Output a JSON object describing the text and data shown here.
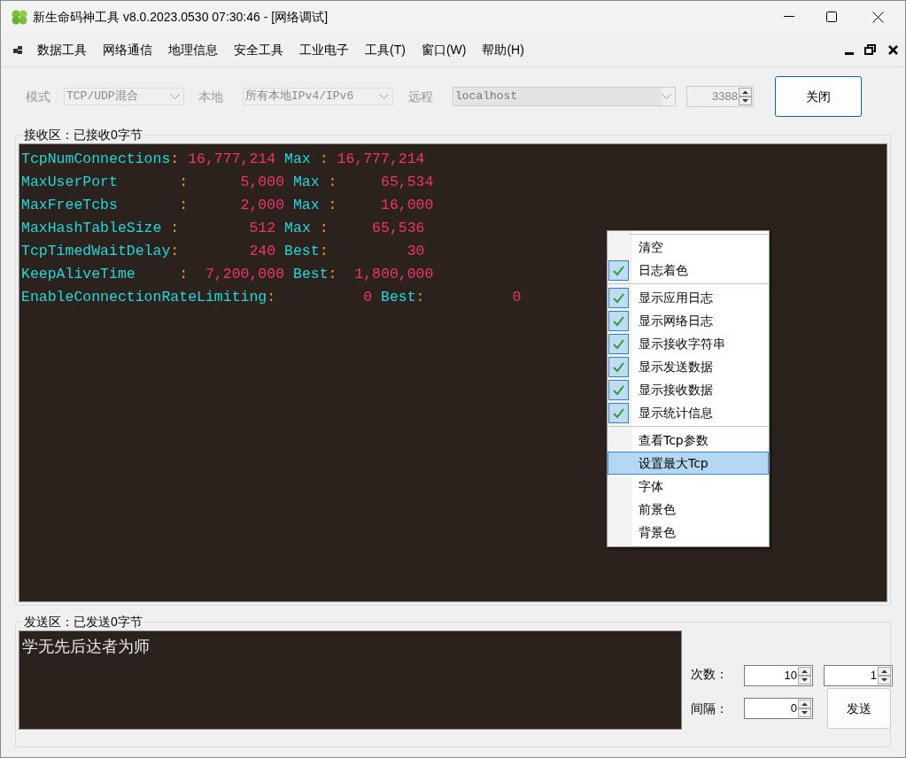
{
  "window": {
    "title": "新生命码神工具 v8.0.2023.0530 07:30:46 - [网络调试]"
  },
  "menu": [
    "数据工具",
    "网络通信",
    "地理信息",
    "安全工具",
    "工业电子",
    "工具(T)",
    "窗口(W)",
    "帮助(H)"
  ],
  "toolbar": {
    "mode_label": "模式",
    "mode": "TCP/UDP混合",
    "local_label": "本地",
    "local": "所有本地IPv4/IPv6",
    "remote_label": "远程",
    "remote": "localhost",
    "port": "3388",
    "close_button": "关闭"
  },
  "receive": {
    "title": "接收区：已接收0字节",
    "lines": [
      [
        {
          "kind": "name",
          "text": "TcpNumConnections"
        },
        {
          "kind": "sep",
          "text": ":"
        },
        {
          "kind": "value",
          "text": " 16,777,214"
        },
        {
          "kind": "label",
          "text": " Max"
        },
        {
          "kind": "sep",
          "text": " :"
        },
        {
          "kind": "value",
          "text": " 16,777,214"
        }
      ],
      [
        {
          "kind": "name",
          "text": "MaxUserPort"
        },
        {
          "kind": "sep",
          "text": "       :"
        },
        {
          "kind": "value",
          "text": "      5,000"
        },
        {
          "kind": "label",
          "text": " Max"
        },
        {
          "kind": "sep",
          "text": " :"
        },
        {
          "kind": "value",
          "text": "     65,534"
        }
      ],
      [
        {
          "kind": "name",
          "text": "MaxFreeTcbs"
        },
        {
          "kind": "sep",
          "text": "       :"
        },
        {
          "kind": "value",
          "text": "      2,000"
        },
        {
          "kind": "label",
          "text": " Max"
        },
        {
          "kind": "sep",
          "text": " :"
        },
        {
          "kind": "value",
          "text": "     16,000"
        }
      ],
      [
        {
          "kind": "name",
          "text": "MaxHashTableSize"
        },
        {
          "kind": "sep",
          "text": " :"
        },
        {
          "kind": "value",
          "text": "        512"
        },
        {
          "kind": "label",
          "text": " Max"
        },
        {
          "kind": "sep",
          "text": " :"
        },
        {
          "kind": "value",
          "text": "     65,536"
        }
      ],
      [
        {
          "kind": "name",
          "text": "TcpTimedWaitDelay"
        },
        {
          "kind": "sep",
          "text": ":"
        },
        {
          "kind": "value",
          "text": "        240"
        },
        {
          "kind": "label",
          "text": " Best"
        },
        {
          "kind": "sep",
          "text": ":"
        },
        {
          "kind": "value",
          "text": "         30"
        }
      ],
      [
        {
          "kind": "name",
          "text": "KeepAliveTime"
        },
        {
          "kind": "sep",
          "text": "     :"
        },
        {
          "kind": "value",
          "text": "  7,200,000"
        },
        {
          "kind": "label",
          "text": " Best"
        },
        {
          "kind": "sep",
          "text": ":"
        },
        {
          "kind": "value",
          "text": "  1,800,000"
        }
      ],
      [
        {
          "kind": "name",
          "text": "EnableConnectionRateLimiting"
        },
        {
          "kind": "sep",
          "text": ":"
        },
        {
          "kind": "value",
          "text": "          0"
        },
        {
          "kind": "label",
          "text": " Best"
        },
        {
          "kind": "sep",
          "text": ":"
        },
        {
          "kind": "value",
          "text": "          0"
        }
      ]
    ]
  },
  "context_menu": [
    [
      {
        "label": "清空",
        "checked": false,
        "selected": false
      },
      {
        "label": "日志着色",
        "checked": true,
        "selected": false
      }
    ],
    [
      {
        "label": "显示应用日志",
        "checked": true,
        "selected": false
      },
      {
        "label": "显示网络日志",
        "checked": true,
        "selected": false
      },
      {
        "label": "显示接收字符串",
        "checked": true,
        "selected": false
      },
      {
        "label": "显示发送数据",
        "checked": true,
        "selected": false
      },
      {
        "label": "显示接收数据",
        "checked": true,
        "selected": false
      },
      {
        "label": "显示统计信息",
        "checked": true,
        "selected": false
      }
    ],
    [
      {
        "label": "查看Tcp参数",
        "checked": false,
        "selected": false
      },
      {
        "label": "设置最大Tcp",
        "checked": false,
        "selected": true
      },
      {
        "label": "字体",
        "checked": false,
        "selected": false
      },
      {
        "label": "前景色",
        "checked": false,
        "selected": false
      },
      {
        "label": "背景色",
        "checked": false,
        "selected": false
      }
    ]
  ],
  "send": {
    "title": "发送区：已发送0字节",
    "text": "学无先后达者为师",
    "count_label": "次数：",
    "count": "10",
    "count_2": "1",
    "interval_label": "间隔：",
    "interval": "0",
    "send_button": "发送"
  }
}
